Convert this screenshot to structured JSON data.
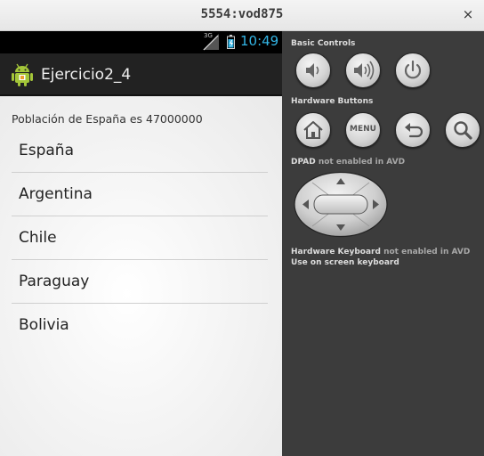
{
  "window": {
    "title": "5554:vod875",
    "close_glyph": "×"
  },
  "status_bar": {
    "network": "3G",
    "time": "10:49",
    "time_color": "#33b5e5"
  },
  "app": {
    "title": "Ejercicio2_4",
    "icon": "android-icon"
  },
  "content": {
    "header": "Población de España es 47000000",
    "countries": [
      "España",
      "Argentina",
      "Chile",
      "Paraguay",
      "Bolivia"
    ]
  },
  "panel": {
    "basic_controls_label": "Basic Controls",
    "hardware_buttons_label": "Hardware Buttons",
    "menu_button_label": "MENU",
    "dpad_label": "DPAD",
    "dpad_note": "not enabled in AVD",
    "keyboard_label": "Hardware Keyboard",
    "keyboard_note": "not enabled in AVD",
    "onscreen_keyboard_label": "Use on screen keyboard",
    "basic_buttons": [
      "volume-down-icon",
      "volume-up-icon",
      "power-icon"
    ],
    "hardware_buttons": [
      "home-icon",
      "menu",
      "back-icon",
      "search-icon"
    ]
  }
}
